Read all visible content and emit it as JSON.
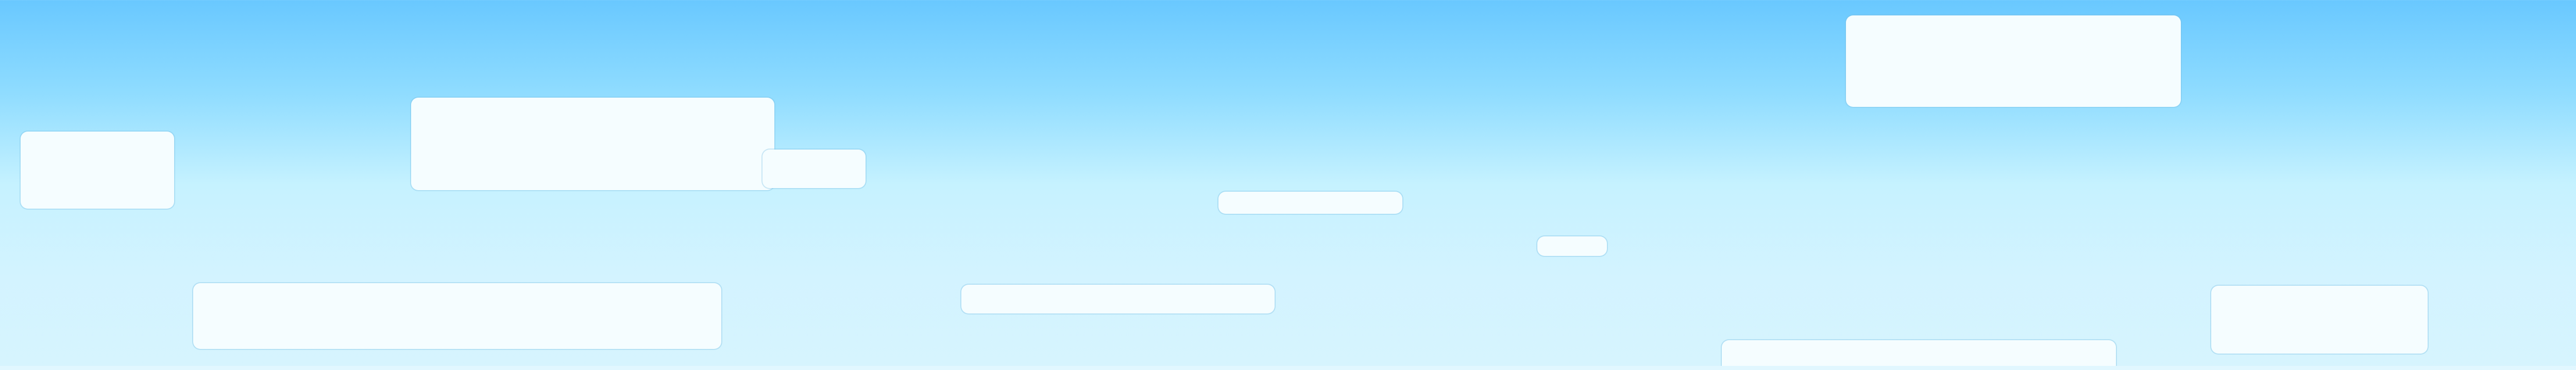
{
  "scene": {
    "type": "side-scroller-sky-level",
    "sky_colors": {
      "top": "#69c8ff",
      "middle": "#c6f2ff",
      "bottom": "#d6f4fe"
    },
    "platform_color": "#f5fdff",
    "platforms": [
      "cloud-platform",
      "cloud-platform",
      "cloud-platform",
      "cloud-platform",
      "cloud-platform",
      "cloud-platform",
      "cloud-platform",
      "cloud-platform",
      "cloud-platform",
      "cloud-platform",
      "cloud-platform",
      "cloud-platform"
    ]
  }
}
